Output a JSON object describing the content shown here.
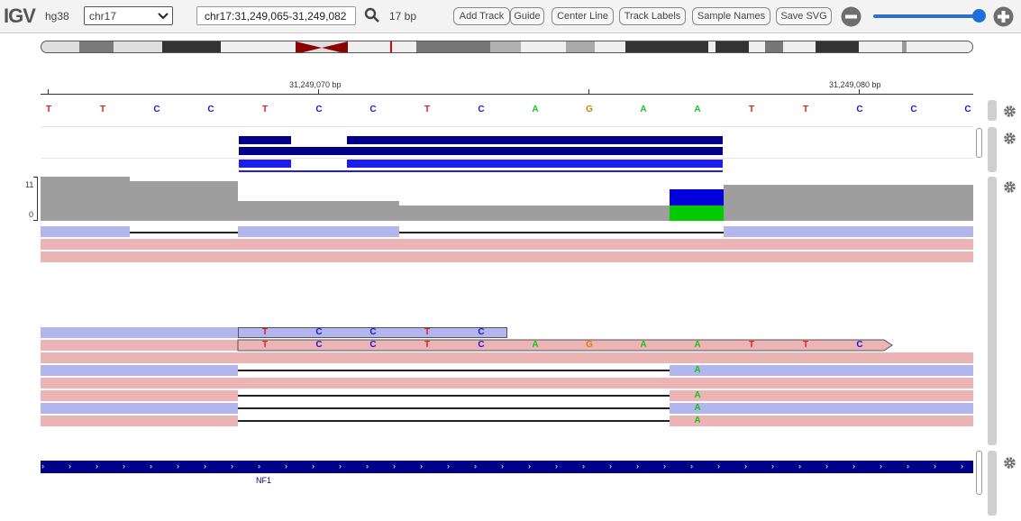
{
  "navbar": {
    "logo": "IGV",
    "genome": "hg38",
    "chromosome": "chr17",
    "locus": "chr17:31,249,065-31,249,082",
    "window_size": "17 bp",
    "buttons": {
      "add_track": "Add Track",
      "guide": "Guide",
      "center_line": "Center Line",
      "track_labels": "Track Labels",
      "sample_names": "Sample Names",
      "save_svg": "Save SVG"
    },
    "zoom_level": 0.95
  },
  "ruler": {
    "ticks": [
      "31,249,070 bp",
      "31,249,080 bp"
    ]
  },
  "sequence": {
    "bases": [
      "T",
      "T",
      "C",
      "C",
      "T",
      "C",
      "C",
      "T",
      "C",
      "A",
      "G",
      "A",
      "A",
      "T",
      "T",
      "C",
      "C",
      "C"
    ],
    "colors": {
      "A": "#18c418",
      "C": "#1a1ad8",
      "G": "#d4800a",
      "T": "#e51c1c"
    }
  },
  "coverage": {
    "scale_max": "11",
    "scale_min": "0",
    "color": "#9e9e9e",
    "mismatch_colors": {
      "A": "#00cc00",
      "C": "#0000dd"
    }
  },
  "alignments": {
    "forward_color": "#b2b6ec",
    "reverse_color": "#edb4b5",
    "mismatch_label": "C"
  },
  "annotation": {
    "gene_name": "NF1",
    "color": "#00008b"
  }
}
